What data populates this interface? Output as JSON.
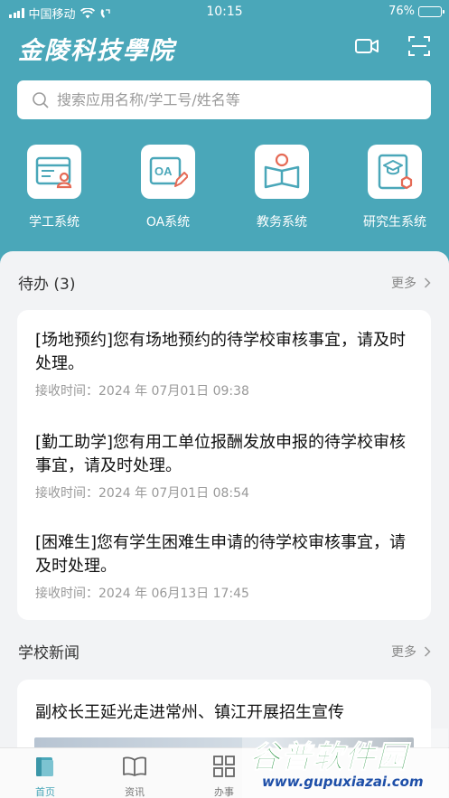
{
  "status_bar": {
    "carrier": "中国移动",
    "time": "10:15",
    "battery": "76%",
    "battery_level": 0.76
  },
  "header": {
    "title": "金陵科技學院",
    "icons": [
      "video-camera-icon",
      "scan-icon"
    ]
  },
  "search": {
    "placeholder": "搜索应用名称/学工号/姓名等"
  },
  "apps": [
    {
      "label": "学工系统",
      "icon": "student-affairs-icon"
    },
    {
      "label": "OA系统",
      "icon": "oa-icon"
    },
    {
      "label": "教务系统",
      "icon": "academic-affairs-icon"
    },
    {
      "label": "研究生系统",
      "icon": "graduate-icon"
    }
  ],
  "todo": {
    "title": "待办 (3)",
    "more": "更多",
    "items": [
      {
        "text": "[场地预约]您有场地预约的待学校审核事宜，请及时处理。",
        "meta": "接收时间：2024 年 07月01日 09:38"
      },
      {
        "text": "[勤工助学]您有用工单位报酬发放申报的待学校审核事宜，请及时处理。",
        "meta": "接收时间：2024 年 07月01日 08:54"
      },
      {
        "text": "[困难生]您有学生困难生申请的待学校审核事宜，请及时处理。",
        "meta": "接收时间：2024 年 06月13日 17:45"
      }
    ]
  },
  "news": {
    "title": "学校新闻",
    "more": "更多",
    "headline": "副校长王延光走进常州、镇江开展招生宣传"
  },
  "tabbar": {
    "tabs": [
      {
        "label": "首页",
        "icon": "home-icon",
        "active": true
      },
      {
        "label": "资讯",
        "icon": "book-icon",
        "active": false
      },
      {
        "label": "办事",
        "icon": "grid-icon",
        "active": false
      }
    ]
  },
  "watermark": {
    "main": "谷普软件园",
    "sub": "www.gupuxiazai.com"
  },
  "colors": {
    "accent": "#4aa7b9",
    "background": "#f2f3f5"
  }
}
